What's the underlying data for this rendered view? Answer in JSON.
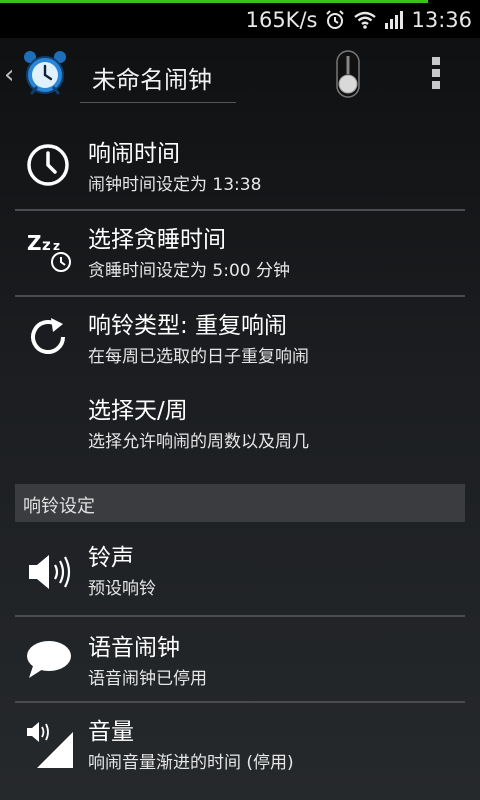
{
  "status_bar": {
    "speed": "165K/s",
    "time": "13:36",
    "icons": [
      "alarm-icon",
      "wifi-icon",
      "signal-icon"
    ]
  },
  "action_bar": {
    "title": "未命名闹钟",
    "back_icon": "chevron-left-icon",
    "app_icon": "alarm-clock-icon",
    "toggle_icon": "toggle-switch-icon",
    "menu_icon": "overflow-menu-icon"
  },
  "settings": {
    "alarm_time": {
      "title": "响闹时间",
      "summary": "闹钟时间设定为 13:38"
    },
    "snooze": {
      "title": "选择贪睡时间",
      "summary": "贪睡时间设定为 5:00 分钟"
    },
    "repeat_type": {
      "title": "响铃类型: 重复响闹",
      "summary": "在每周已选取的日子重复响闹"
    },
    "days_week": {
      "title": "选择天/周",
      "summary": "选择允许响闹的周数以及周几"
    }
  },
  "ring_section": {
    "header": "响铃设定",
    "ringtone": {
      "title": "铃声",
      "summary": "预设响铃"
    },
    "voice": {
      "title": "语音闹钟",
      "summary": "语音闹钟已停用"
    },
    "volume": {
      "title": "音量",
      "summary": "响闹音量渐进的时间 (停用)"
    }
  },
  "colors": {
    "progress": "#3fbf1f",
    "section_header": "#3a3c3f",
    "divider": "#4a4c4f"
  }
}
